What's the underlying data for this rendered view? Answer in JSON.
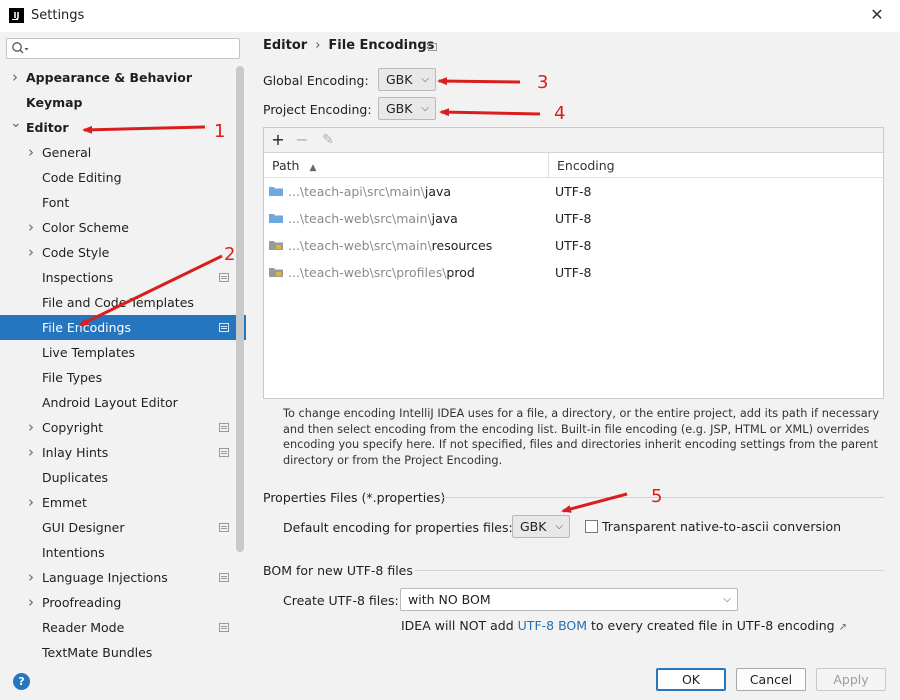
{
  "window": {
    "title": "Settings",
    "close_glyph": "✕",
    "logo_text": "IJ"
  },
  "search": {
    "placeholder": "",
    "value": ""
  },
  "sidebar": {
    "items": [
      {
        "label": "Appearance & Behavior",
        "level": 0,
        "bold": true,
        "chevron": "right",
        "selected": false,
        "icon": false
      },
      {
        "label": "Keymap",
        "level": 0,
        "bold": true,
        "chevron": "",
        "selected": false,
        "icon": false
      },
      {
        "label": "Editor",
        "level": 0,
        "bold": true,
        "chevron": "down",
        "selected": false,
        "icon": false
      },
      {
        "label": "General",
        "level": 1,
        "bold": false,
        "chevron": "right",
        "selected": false,
        "icon": false
      },
      {
        "label": "Code Editing",
        "level": 1,
        "bold": false,
        "chevron": "",
        "selected": false,
        "icon": false
      },
      {
        "label": "Font",
        "level": 1,
        "bold": false,
        "chevron": "",
        "selected": false,
        "icon": false
      },
      {
        "label": "Color Scheme",
        "level": 1,
        "bold": false,
        "chevron": "right",
        "selected": false,
        "icon": false
      },
      {
        "label": "Code Style",
        "level": 1,
        "bold": false,
        "chevron": "right",
        "selected": false,
        "icon": false
      },
      {
        "label": "Inspections",
        "level": 1,
        "bold": false,
        "chevron": "",
        "selected": false,
        "icon": true
      },
      {
        "label": "File and Code Templates",
        "level": 1,
        "bold": false,
        "chevron": "",
        "selected": false,
        "icon": false
      },
      {
        "label": "File Encodings",
        "level": 1,
        "bold": false,
        "chevron": "",
        "selected": true,
        "icon": true
      },
      {
        "label": "Live Templates",
        "level": 1,
        "bold": false,
        "chevron": "",
        "selected": false,
        "icon": false
      },
      {
        "label": "File Types",
        "level": 1,
        "bold": false,
        "chevron": "",
        "selected": false,
        "icon": false
      },
      {
        "label": "Android Layout Editor",
        "level": 1,
        "bold": false,
        "chevron": "",
        "selected": false,
        "icon": false
      },
      {
        "label": "Copyright",
        "level": 1,
        "bold": false,
        "chevron": "right",
        "selected": false,
        "icon": true
      },
      {
        "label": "Inlay Hints",
        "level": 1,
        "bold": false,
        "chevron": "right",
        "selected": false,
        "icon": true
      },
      {
        "label": "Duplicates",
        "level": 1,
        "bold": false,
        "chevron": "",
        "selected": false,
        "icon": false
      },
      {
        "label": "Emmet",
        "level": 1,
        "bold": false,
        "chevron": "right",
        "selected": false,
        "icon": false
      },
      {
        "label": "GUI Designer",
        "level": 1,
        "bold": false,
        "chevron": "",
        "selected": false,
        "icon": true
      },
      {
        "label": "Intentions",
        "level": 1,
        "bold": false,
        "chevron": "",
        "selected": false,
        "icon": false
      },
      {
        "label": "Language Injections",
        "level": 1,
        "bold": false,
        "chevron": "right",
        "selected": false,
        "icon": true
      },
      {
        "label": "Proofreading",
        "level": 1,
        "bold": false,
        "chevron": "right",
        "selected": false,
        "icon": false
      },
      {
        "label": "Reader Mode",
        "level": 1,
        "bold": false,
        "chevron": "",
        "selected": false,
        "icon": true
      },
      {
        "label": "TextMate Bundles",
        "level": 1,
        "bold": false,
        "chevron": "",
        "selected": false,
        "icon": false
      }
    ]
  },
  "breadcrumb": {
    "parent": "Editor",
    "separator": "›",
    "current": "File Encodings"
  },
  "global_encoding": {
    "label": "Global Encoding:",
    "value": "GBK"
  },
  "project_encoding": {
    "label": "Project Encoding:",
    "value": "GBK"
  },
  "table": {
    "toolbar": {
      "add": "+",
      "remove": "−",
      "edit": "✎"
    },
    "columns": {
      "path": "Path",
      "sort_glyph": "▲",
      "encoding": "Encoding"
    },
    "rows": [
      {
        "dim": "...\\teach-api\\src\\main\\",
        "strong": "java",
        "encoding": "UTF-8",
        "folder": "source"
      },
      {
        "dim": "...\\teach-web\\src\\main\\",
        "strong": "java",
        "encoding": "UTF-8",
        "folder": "source"
      },
      {
        "dim": "...\\teach-web\\src\\main\\",
        "strong": "resources",
        "encoding": "UTF-8",
        "folder": "resource"
      },
      {
        "dim": "...\\teach-web\\src\\profiles\\",
        "strong": "prod",
        "encoding": "UTF-8",
        "folder": "resource"
      }
    ]
  },
  "help_text": "To change encoding IntelliJ IDEA uses for a file, a directory, or the entire project, add its path if necessary and then select encoding from the encoding list. Built-in file encoding (e.g. JSP, HTML or XML) overrides encoding you specify here. If not specified, files and directories inherit encoding settings from the parent directory or from the Project Encoding.",
  "properties": {
    "section_title": "Properties Files (*.properties)",
    "default_label": "Default encoding for properties files:",
    "default_value": "GBK",
    "transparent_label": "Transparent native-to-ascii conversion",
    "transparent_checked": false
  },
  "bom": {
    "section_title": "BOM for new UTF-8 files",
    "create_label": "Create UTF-8 files:",
    "create_value": "with NO BOM",
    "note_prefix": "IDEA will NOT add ",
    "note_link": "UTF-8 BOM",
    "note_suffix": " to every created file in UTF-8 encoding",
    "note_arrow": "↗"
  },
  "footer": {
    "help": "?",
    "ok": "OK",
    "cancel": "Cancel",
    "apply": "Apply"
  },
  "annotations": [
    "1",
    "2",
    "3",
    "4",
    "5"
  ],
  "colors": {
    "selection": "#2675bf",
    "annotation_red": "#d81e1e",
    "link": "#2470b3",
    "source_folder": "#6fa8dc",
    "resource_folder": "#9a9a9a"
  }
}
